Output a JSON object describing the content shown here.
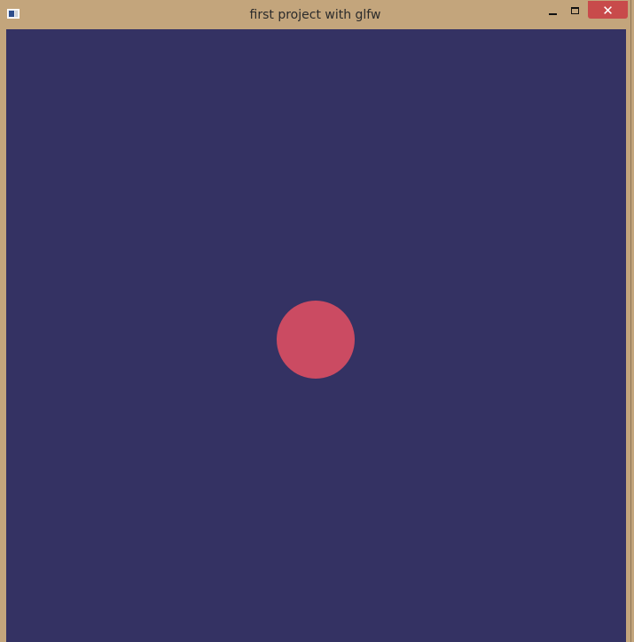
{
  "window": {
    "title": "first project with glfw"
  },
  "colors": {
    "frame": "#c3a57c",
    "canvas_background": "#343263",
    "circle": "#cb4b62",
    "close_button": "#c84b4b"
  },
  "icons": {
    "app": "window-app-icon",
    "minimize": "minimize-icon",
    "maximize": "maximize-icon",
    "close": "close-icon"
  },
  "controls": {
    "close_glyph": "✕"
  }
}
